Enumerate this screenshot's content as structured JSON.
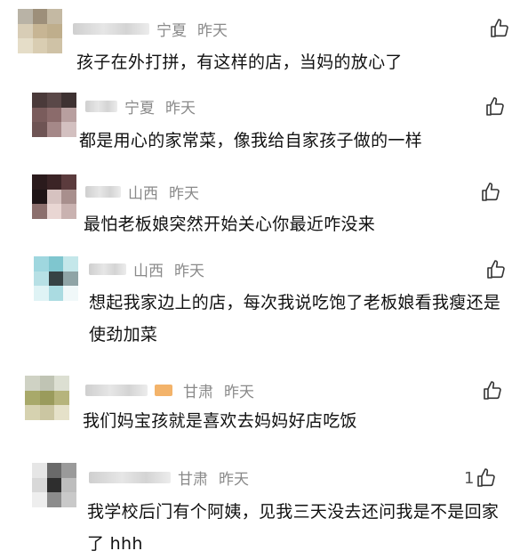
{
  "comments": [
    {
      "region": "宁夏",
      "time": "昨天",
      "text": "孩子在外打拼，有这样的店，当妈的放心了",
      "likes": "",
      "avatar_colors": [
        "#b9b3a6",
        "#9d8f7a",
        "#c4b9a3",
        "#d8cdb6",
        "#c7b594",
        "#bfae8c",
        "#e5ddc8",
        "#d9cdb2",
        "#cfc2a6"
      ]
    },
    {
      "region": "宁夏",
      "time": "昨天",
      "text": "都是用心的家常菜，像我给自家孩子做的一样",
      "likes": "",
      "avatar_colors": [
        "#4a3a3a",
        "#5a4848",
        "#3e3232",
        "#7a5c5c",
        "#8b6b6b",
        "#b89f9f",
        "#6e5454",
        "#a58888",
        "#d3c0c0"
      ]
    },
    {
      "region": "山西",
      "time": "昨天",
      "text": "最怕老板娘突然开始关心你最近咋没来",
      "likes": "",
      "avatar_colors": [
        "#2a1a1c",
        "#3b2426",
        "#5b3b3d",
        "#1e1416",
        "#d6c2c0",
        "#a88f8d",
        "#8c6f6d",
        "#e9d6d3",
        "#c9b2b0"
      ]
    },
    {
      "region": "山西",
      "time": "昨天",
      "text": "想起我家边上的店，每次我说吃饱了老板娘看我瘦还是使劲加菜",
      "likes": "",
      "avatar_colors": [
        "#9fd7df",
        "#7fc6cf",
        "#c4e7ea",
        "#b7e0e5",
        "#364244",
        "#8fa4a6",
        "#dff3f5",
        "#aadbe1",
        "#f0f8f9"
      ]
    },
    {
      "region": "甘肃",
      "time": "昨天",
      "text": "我们妈宝孩就是喜欢去妈妈好店吃饭",
      "likes": "",
      "avatar_colors": [
        "#cfd2c4",
        "#c0c4b4",
        "#dcdfd2",
        "#a8a96a",
        "#9a9b5c",
        "#b6b47c",
        "#d6d2b0",
        "#cbc6a2",
        "#e5e1c9"
      ]
    },
    {
      "region": "甘肃",
      "time": "昨天",
      "text": "我学校后门有个阿姨，见我三天没去还问我是不是回家了 hhh",
      "likes": "1",
      "avatar_colors": [
        "#e6e6e6",
        "#6a6a6a",
        "#9a9a9a",
        "#d8d8d8",
        "#2e2e2e",
        "#bdbdbd",
        "#eeeeee",
        "#8c8c8c",
        "#c9c9c9"
      ]
    }
  ]
}
